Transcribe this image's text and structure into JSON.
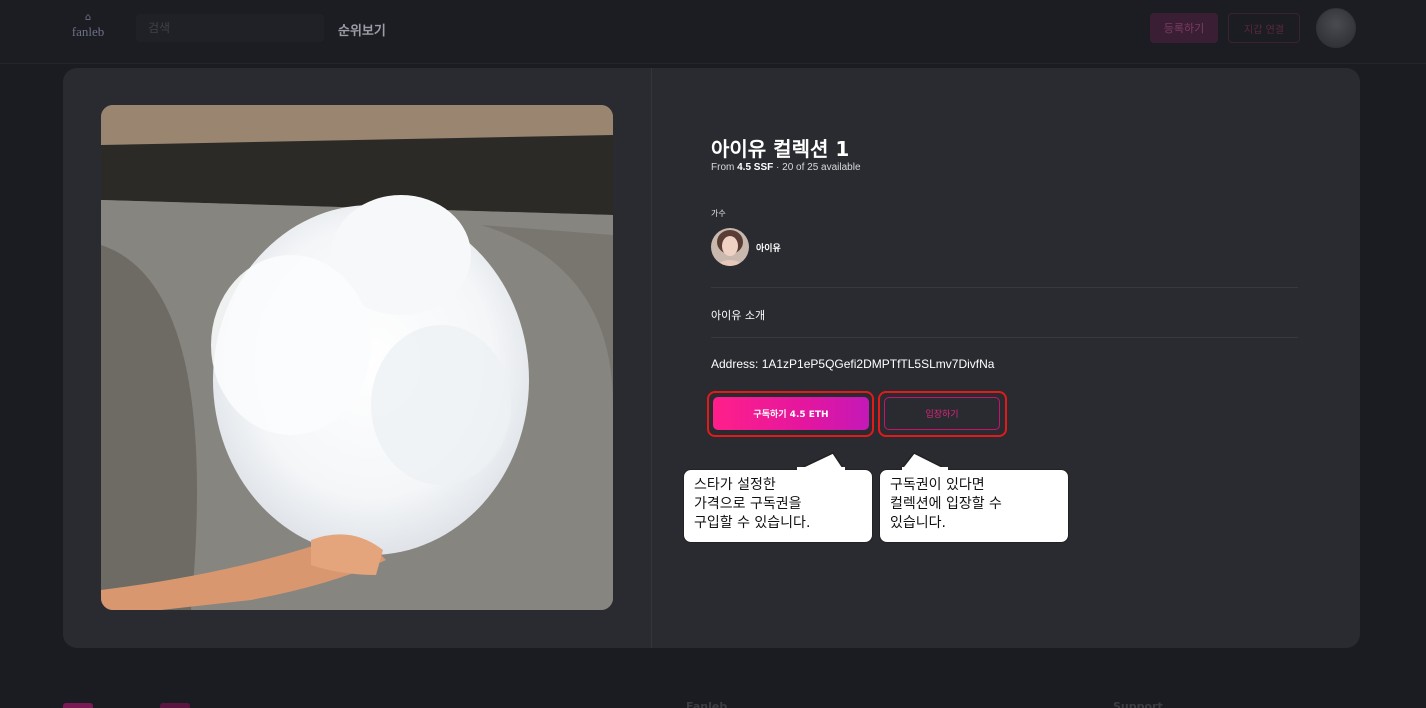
{
  "header": {
    "logo_text": "fanleb",
    "search_placeholder": "검색",
    "ranking_label": "순위보기",
    "register_label": "등록하기",
    "connect_label": "지갑 연결"
  },
  "collection": {
    "title": "아이유 컬렉션 1",
    "price_prefix": "From ",
    "price": "4.5 SSF",
    "availability": " · 20 of 25 available",
    "artist_label": "가수",
    "artist_name": "아이유",
    "intro": "아이유 소개",
    "address_label": "Address: ",
    "address": "1A1zP1eP5QGefi2DMPTfTL5SLmv7DivfNa",
    "subscribe_label": "구독하기 4.5 ETH",
    "enter_label": "입장하기"
  },
  "callouts": {
    "subscribe": "스타가 설정한\n가격으로 구독권을\n구입할 수 있습니다.",
    "enter": "구독권이 있다면\n컬렉션에 입장할 수\n있습니다."
  },
  "footer": {
    "fanleb": "Fanleb",
    "support": "Support"
  },
  "colors": {
    "accent": "#e3169f",
    "background": "#1b1c21",
    "card": "#2a2b30",
    "highlight": "#e21a1a"
  },
  "icons": {
    "logo": "fanleb-logo-icon",
    "avatar": "user-avatar-icon"
  }
}
